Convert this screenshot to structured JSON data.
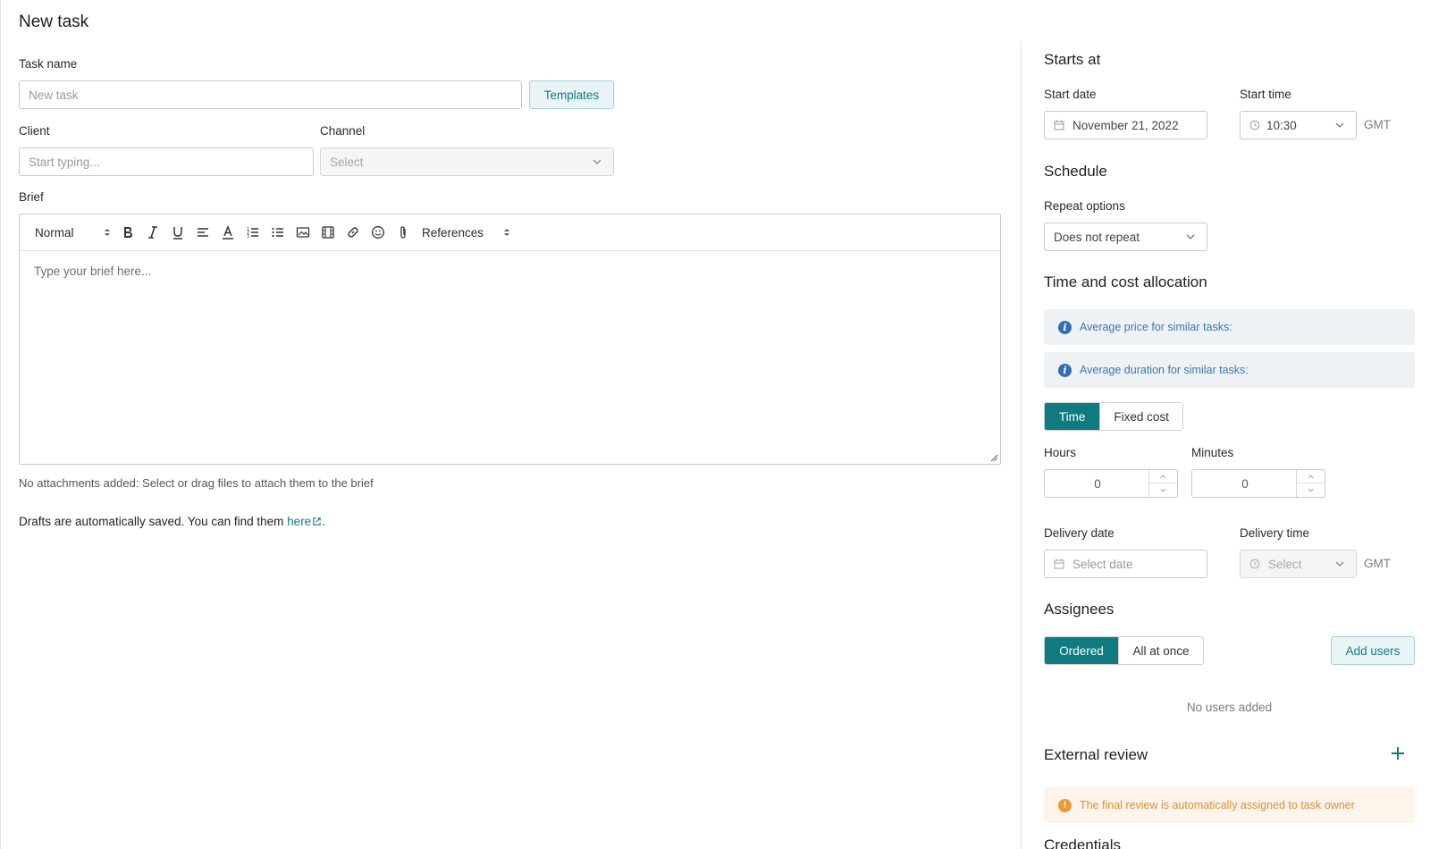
{
  "page": {
    "title": "New task"
  },
  "task_name": {
    "label": "Task name",
    "placeholder": "New task",
    "templates_button": "Templates"
  },
  "client": {
    "label": "Client",
    "placeholder": "Start typing..."
  },
  "channel": {
    "label": "Channel",
    "placeholder": "Select"
  },
  "brief": {
    "label": "Brief",
    "toolbar": {
      "style_select": "Normal",
      "references_select": "References",
      "icons": [
        "bold-icon",
        "italic-icon",
        "underline-icon",
        "align-icon",
        "text-color-icon",
        "ordered-list-icon",
        "bullet-list-icon",
        "image-icon",
        "video-icon",
        "link-icon",
        "emoji-icon",
        "attachment-icon"
      ]
    },
    "placeholder": "Type your brief here...",
    "attachments_note": "No attachments added: Select or drag files to attach them to the brief"
  },
  "drafts": {
    "text": "Drafts are automatically saved. You can find them ",
    "link": "here",
    "suffix": "."
  },
  "starts_at": {
    "heading": "Starts at",
    "start_date_label": "Start date",
    "start_date_value": "November 21, 2022",
    "start_time_label": "Start time",
    "start_time_value": "10:30",
    "timezone": "GMT"
  },
  "schedule": {
    "heading": "Schedule",
    "repeat_label": "Repeat options",
    "repeat_value": "Does not repeat"
  },
  "allocation": {
    "heading": "Time and cost allocation",
    "avg_price": "Average price for similar tasks:",
    "avg_duration": "Average duration for similar tasks:",
    "toggle": {
      "time": "Time",
      "fixed": "Fixed cost",
      "selected": "Time"
    },
    "hours_label": "Hours",
    "hours_value": "0",
    "minutes_label": "Minutes",
    "minutes_value": "0",
    "delivery_date_label": "Delivery date",
    "delivery_date_placeholder": "Select date",
    "delivery_time_label": "Delivery time",
    "delivery_time_placeholder": "Select",
    "timezone": "GMT"
  },
  "assignees": {
    "heading": "Assignees",
    "toggle": {
      "ordered": "Ordered",
      "all": "All at once",
      "selected": "Ordered"
    },
    "add_button": "Add users",
    "empty": "No users added"
  },
  "external_review": {
    "heading": "External review",
    "warning": "The final review is automatically assigned to task owner"
  },
  "credentials": {
    "heading": "Credentials"
  },
  "colors": {
    "accent": "#0f7a7f",
    "info": "#3c76b3",
    "warning": "#e89a2e"
  }
}
